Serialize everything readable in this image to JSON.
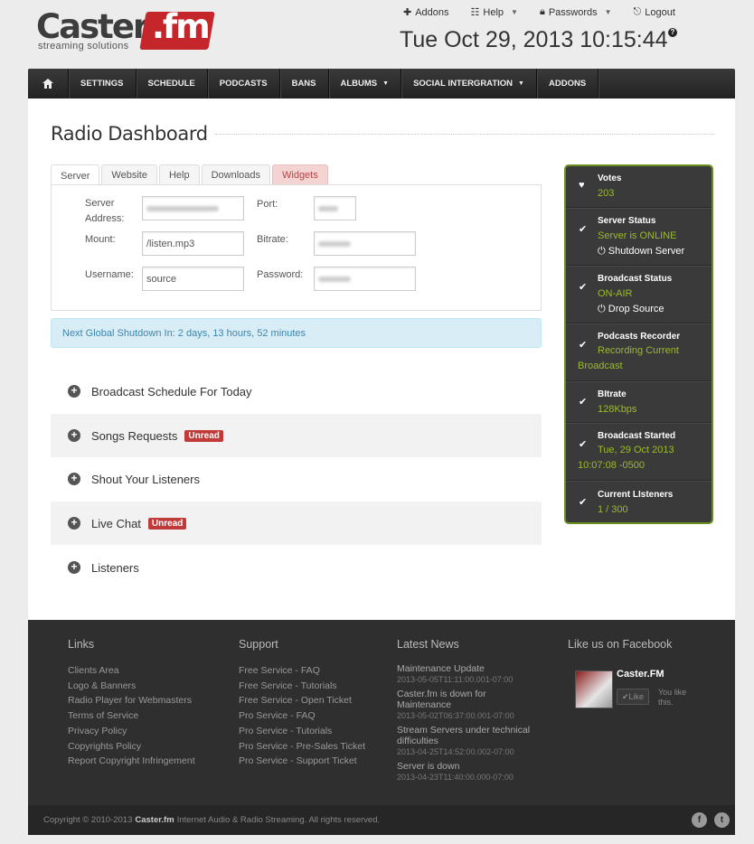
{
  "brand": {
    "name": "Caster",
    "suffix": ".fm",
    "tagline": "streaming solutions"
  },
  "toplinks": [
    {
      "icon": "plus-icon",
      "label": "Addons",
      "caret": false
    },
    {
      "icon": "grid-icon",
      "label": "Help",
      "caret": true
    },
    {
      "icon": "lock-icon",
      "label": "Passwords",
      "caret": true
    },
    {
      "icon": "logout-icon",
      "label": "Logout",
      "caret": false
    }
  ],
  "clock": "Tue Oct 29, 2013 10:15:44",
  "nav": {
    "home_icon": "home-icon",
    "items": [
      "SETTINGS",
      "SCHEDULE",
      "PODCASTS",
      "BANS",
      "ALBUMS",
      "SOCIAL INTERGRATION",
      "ADDONS"
    ]
  },
  "page_title": "Radio Dashboard",
  "tabs": [
    "Server",
    "Website",
    "Help",
    "Downloads",
    "Widgets"
  ],
  "form": {
    "server_address_label": "Server Address:",
    "port_label": "Port:",
    "mount_label": "Mount:",
    "mount_value": "/listen.mp3",
    "bitrate_label": "Bitrate:",
    "username_label": "Username:",
    "username_value": "source",
    "password_label": "Password:"
  },
  "alert": "Next Global Shutdown In: 2 days, 13 hours, 52 minutes",
  "accordion": [
    {
      "label": "Broadcast Schedule For Today",
      "badge": ""
    },
    {
      "label": "Songs Requests",
      "badge": "Unread"
    },
    {
      "label": "Shout Your Listeners",
      "badge": ""
    },
    {
      "label": "Live Chat",
      "badge": "Unread"
    },
    {
      "label": "Listeners",
      "badge": ""
    }
  ],
  "status": {
    "votes_title": "Votes",
    "votes_value": "203",
    "server_title": "Server Status",
    "server_value": "Server is ONLINE",
    "server_action": "Shutdown Server",
    "broadcast_title": "Broadcast Status",
    "broadcast_value": "ON-AIR",
    "broadcast_action": "Drop Source",
    "recorder_title": "Podcasts Recorder",
    "recorder_value": "Recording Current Broadcast",
    "bitrate_title": "BItrate",
    "bitrate_value": "128Kbps",
    "started_title": "Broadcast Started",
    "started_value": "Tue, 29 Oct 2013 10:07:08 -0500",
    "listeners_title": "Current LIsteners",
    "listeners_value": "1 / 300",
    "accent": "#9aba2c"
  },
  "footer": {
    "links_title": "Links",
    "links": [
      "Clients Area",
      "Logo & Banners",
      "Radio Player for Webmasters",
      "Terms of Service",
      "Privacy Policy",
      "Copyrights Policy",
      "Report Copyright Infringement"
    ],
    "support_title": "Support",
    "support": [
      "Free Service - FAQ",
      "Free Service - Tutorials",
      "Free Service - Open Ticket",
      "Pro Service - FAQ",
      "Pro Service - Tutorials",
      "Pro Service - Pre-Sales Ticket",
      "Pro Service - Support Ticket"
    ],
    "news_title": "Latest News",
    "news": [
      {
        "title": "Maintenance Update",
        "date": "2013-05-05T11:11:00.001-07:00"
      },
      {
        "title": "Caster.fm is down for Maintenance",
        "date": "2013-05-02T06:37:00.001-07:00"
      },
      {
        "title": "Stream Servers under technical difficulties",
        "date": "2013-04-25T14:52:00.002-07:00"
      },
      {
        "title": "Server is down",
        "date": "2013-04-23T11:40:00.000-07:00"
      }
    ],
    "facebook_title": "Like us on Facebook",
    "facebook_name": "Caster.FM",
    "facebook_like": "Like",
    "facebook_text": "You like this."
  },
  "copyright": {
    "prefix": "Copyright © 2010-2013",
    "brand": "Caster.fm",
    "suffix": "Internet Audio & Radio Streaming. All rights reserved."
  }
}
